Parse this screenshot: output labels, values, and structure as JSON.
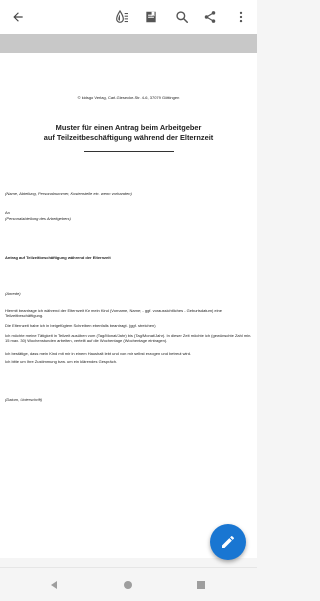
{
  "toolbar": {
    "icons": [
      "back-arrow-icon",
      "brightness-icon",
      "bookmark-icon",
      "search-icon",
      "share-icon",
      "more-vert-icon"
    ]
  },
  "document": {
    "publisher_line": "© kidsgo Verlag, Carl-Giesecke-Str. 4-6, 37079 Göttingen",
    "title_line1": "Muster für einen Antrag beim Arbeitgeber",
    "title_line2": "auf Teilzeitbeschäftigung während der Elternzeit",
    "sender_hint": "(Name, Abteilung, Personalnummer, Kostenstelle etc. wenn vorhanden)",
    "to_label": "An",
    "to_hint": "(Personalabteilung des Arbeitgebers)",
    "subject": "Antrag auf Teilzeitbeschäftigung während der Elternzeit",
    "salutation": "(Anrede)",
    "para1": "Hiermit beantrage ich während der Elternzeit für mein Kind (Vorname, Name; - ggf. voraussichtliches - Geburtsdatum) eine Teilzeitbeschäftigung.",
    "para2": "Die Elternzeit habe ich in beigefügtem Schreiben ebenfalls beantragt. (ggf. streichen)",
    "para3": "Ich möchte meine Tätigkeit in Teilzeit ausüben vom (Tag/Monat/Jahr) bis (Tag/Monat/Jahr). In dieser Zeit möchte ich (gewünschte Zahl min. 15 max. 30) Wochenstunden arbeiten, verteilt auf die Wochentage (Wochentage eintragen).",
    "para4": "Ich bestätige, dass mein Kind mit mir in einem Haushalt lebt und von mir selbst erzogen und betreut wird.",
    "para5": "Ich bitte um Ihre Zustimmung bzw. um ein klärendes Gespräch.",
    "signature_hint": "(Datum, Unterschrift)"
  },
  "fab": {
    "icon": "edit-pencil-icon",
    "color": "#1976d2"
  },
  "navbar": {
    "icons": [
      "nav-back-icon",
      "nav-home-icon",
      "nav-recents-icon"
    ]
  }
}
